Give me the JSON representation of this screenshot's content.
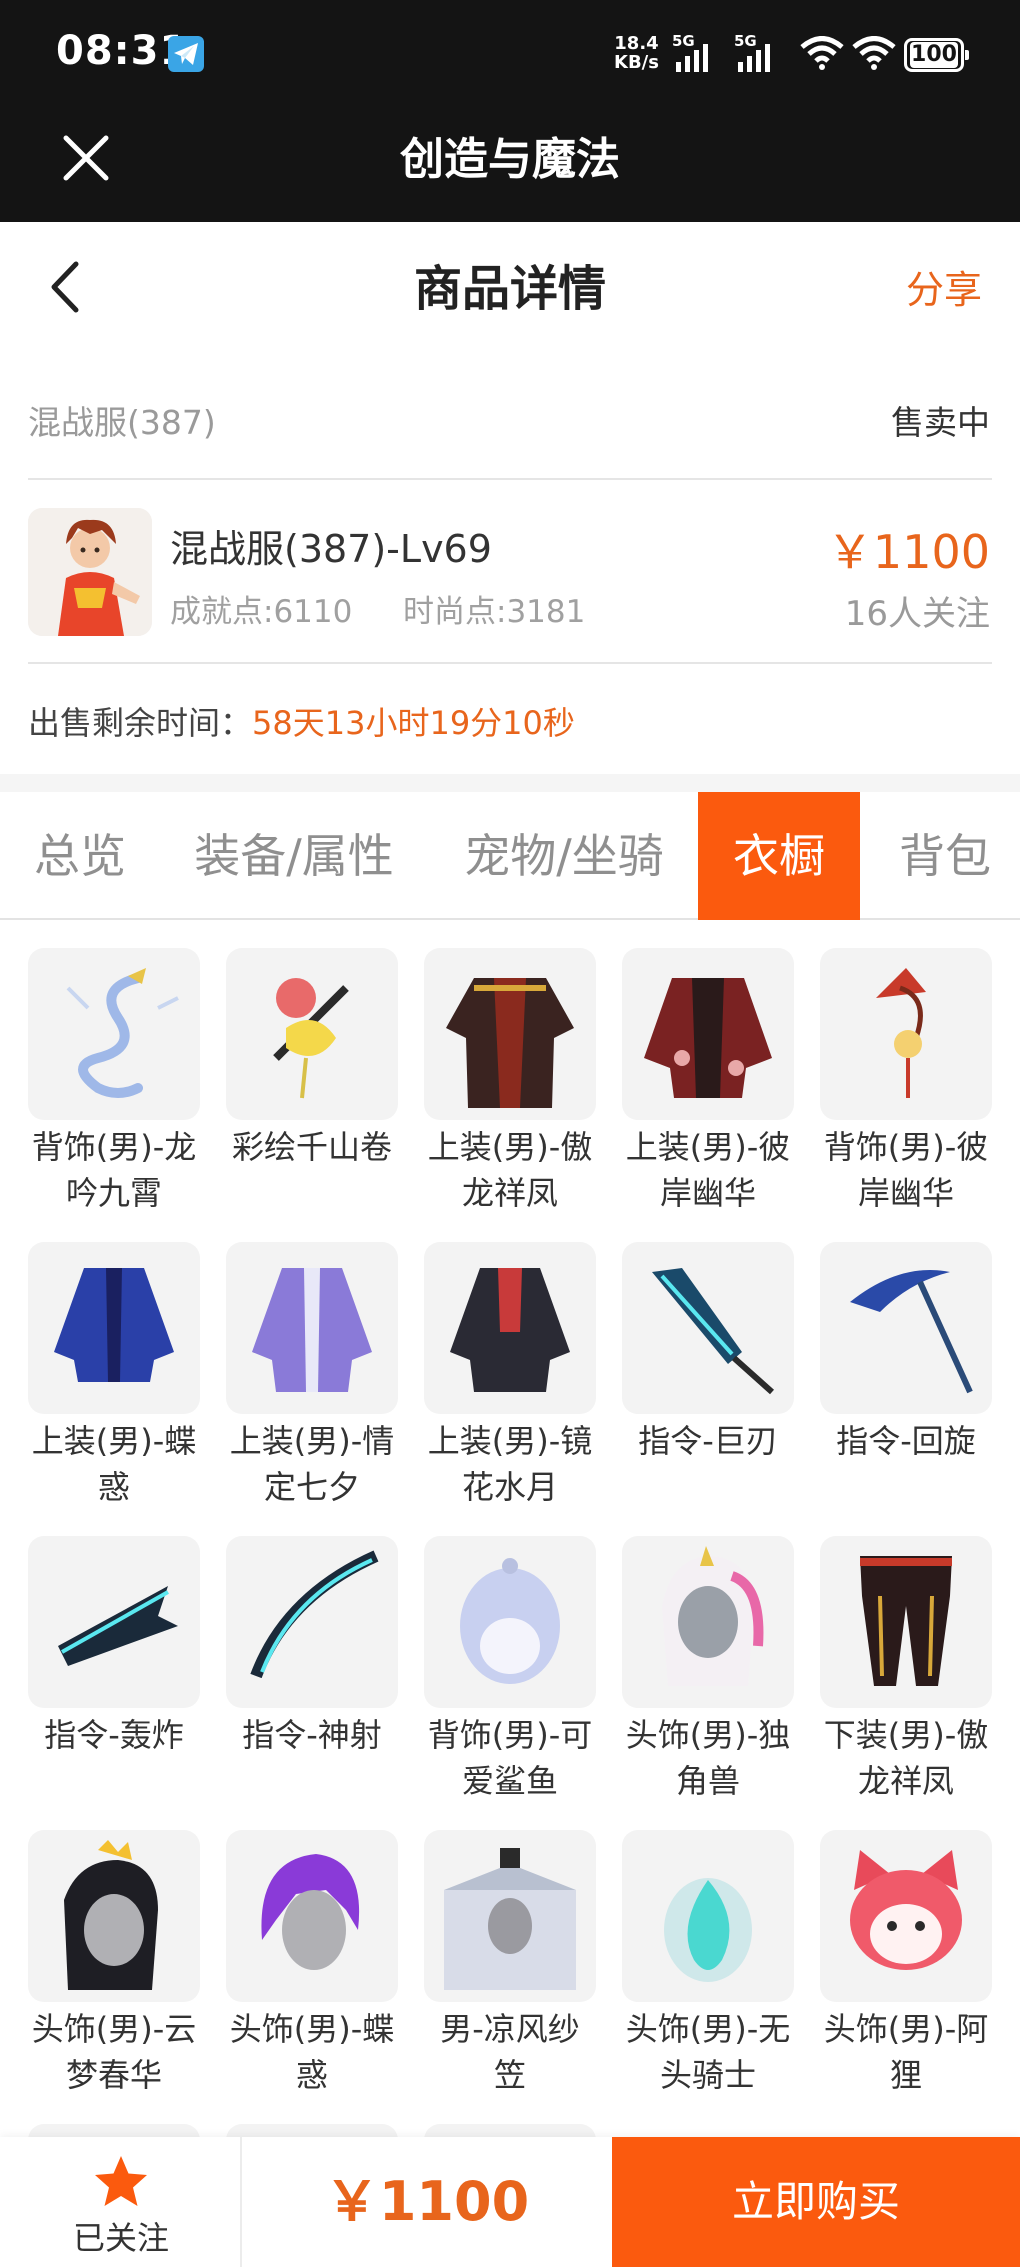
{
  "status_bar": {
    "time": "08:31",
    "net_speed_value": "18.4",
    "net_speed_unit": "KB/s",
    "signal1": "5G",
    "signal2": "5G",
    "battery": "100"
  },
  "app_header": {
    "title": "创造与魔法"
  },
  "page_nav": {
    "title": "商品详情",
    "share": "分享"
  },
  "listing": {
    "server": "混战服(387)",
    "status": "售卖中",
    "character_name": "混战服(387)-Lv69",
    "achievement": "成就点:6110",
    "fashion": "时尚点:3181",
    "price": "￥1100",
    "followers": "16人关注",
    "remaining_label": "出售剩余时间：",
    "remaining_value": "58天13小时19分10秒"
  },
  "tabs": [
    {
      "label": "总览",
      "active": false
    },
    {
      "label": "装备/属性",
      "active": false
    },
    {
      "label": "宠物/坐骑",
      "active": false
    },
    {
      "label": "衣橱",
      "active": true
    },
    {
      "label": "背包",
      "active": false
    }
  ],
  "wardrobe": [
    {
      "line1": "背饰(男)-龙",
      "line2": "吟九霄",
      "icon": "dragon-icon"
    },
    {
      "line1": "彩绘千山卷",
      "line2": "",
      "icon": "scroll-icon"
    },
    {
      "line1": "上装(男)-傲",
      "line2": "龙祥凤",
      "icon": "robe-icon"
    },
    {
      "line1": "上装(男)-彼",
      "line2": "岸幽华",
      "icon": "robe-icon"
    },
    {
      "line1": "背饰(男)-彼",
      "line2": "岸幽华",
      "icon": "fan-icon"
    },
    {
      "line1": "上装(男)-蝶",
      "line2": "惑",
      "icon": "coat-icon"
    },
    {
      "line1": "上装(男)-情",
      "line2": "定七夕",
      "icon": "coat-icon"
    },
    {
      "line1": "上装(男)-镜",
      "line2": "花水月",
      "icon": "coat-icon"
    },
    {
      "line1": "指令-巨刃",
      "line2": "",
      "icon": "blade-icon"
    },
    {
      "line1": "指令-回旋",
      "line2": "",
      "icon": "scythe-icon"
    },
    {
      "line1": "指令-轰炸",
      "line2": "",
      "icon": "jet-icon"
    },
    {
      "line1": "指令-神射",
      "line2": "",
      "icon": "bow-icon"
    },
    {
      "line1": "背饰(男)-可",
      "line2": "爱鲨鱼",
      "icon": "shark-icon"
    },
    {
      "line1": "头饰(男)-独",
      "line2": "角兽",
      "icon": "unicorn-hood-icon"
    },
    {
      "line1": "下装(男)-傲",
      "line2": "龙祥凤",
      "icon": "pants-icon"
    },
    {
      "line1": "头饰(男)-云",
      "line2": "梦春华",
      "icon": "hair-icon"
    },
    {
      "line1": "头饰(男)-蝶",
      "line2": "惑",
      "icon": "hair-icon"
    },
    {
      "line1": "男-凉风纱",
      "line2": "笠",
      "icon": "veil-hat-icon"
    },
    {
      "line1": "头饰(男)-无",
      "line2": "头骑士",
      "icon": "flame-icon"
    },
    {
      "line1": "头饰(男)-阿",
      "line2": "狸",
      "icon": "fox-head-icon"
    }
  ],
  "bottom_bar": {
    "fav_label": "已关注",
    "price": "￥1100",
    "buy": "立即购买"
  },
  "colors": {
    "accent": "#fb5a0e",
    "price_text": "#e8651c",
    "header_bg": "#141414"
  }
}
